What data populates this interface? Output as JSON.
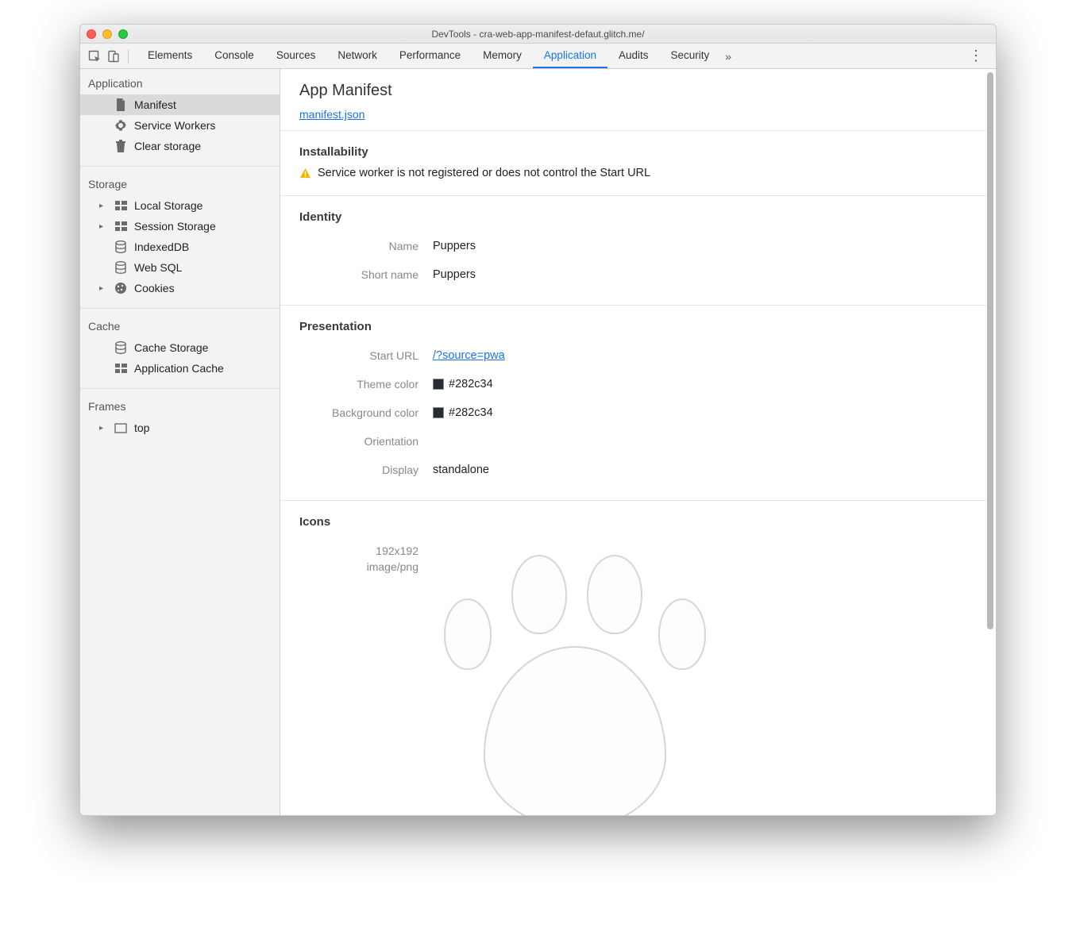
{
  "window": {
    "title": "DevTools - cra-web-app-manifest-defaut.glitch.me/"
  },
  "tabs": {
    "items": [
      "Elements",
      "Console",
      "Sources",
      "Network",
      "Performance",
      "Memory",
      "Application",
      "Audits",
      "Security"
    ],
    "active": "Application"
  },
  "sidebar": {
    "groups": [
      {
        "title": "Application",
        "items": [
          {
            "id": "manifest",
            "label": "Manifest",
            "icon": "file",
            "selected": true
          },
          {
            "id": "sw",
            "label": "Service Workers",
            "icon": "gear"
          },
          {
            "id": "clear",
            "label": "Clear storage",
            "icon": "trash"
          }
        ]
      },
      {
        "title": "Storage",
        "items": [
          {
            "id": "local",
            "label": "Local Storage",
            "icon": "grid",
            "tree": true
          },
          {
            "id": "session",
            "label": "Session Storage",
            "icon": "grid",
            "tree": true
          },
          {
            "id": "idb",
            "label": "IndexedDB",
            "icon": "db"
          },
          {
            "id": "websql",
            "label": "Web SQL",
            "icon": "db"
          },
          {
            "id": "cookies",
            "label": "Cookies",
            "icon": "cookie",
            "tree": true
          }
        ]
      },
      {
        "title": "Cache",
        "items": [
          {
            "id": "cachestore",
            "label": "Cache Storage",
            "icon": "db"
          },
          {
            "id": "appcache",
            "label": "Application Cache",
            "icon": "grid"
          }
        ]
      },
      {
        "title": "Frames",
        "items": [
          {
            "id": "top",
            "label": "top",
            "icon": "frame",
            "tree": true
          }
        ]
      }
    ]
  },
  "manifest": {
    "title": "App Manifest",
    "link": "manifest.json",
    "installability": {
      "heading": "Installability",
      "warning": "Service worker is not registered or does not control the Start URL"
    },
    "identity": {
      "heading": "Identity",
      "name_label": "Name",
      "name": "Puppers",
      "shortname_label": "Short name",
      "shortname": "Puppers"
    },
    "presentation": {
      "heading": "Presentation",
      "starturl_label": "Start URL",
      "starturl": "/?source=pwa",
      "theme_label": "Theme color",
      "theme": "#282c34",
      "bg_label": "Background color",
      "bg": "#282c34",
      "orientation_label": "Orientation",
      "orientation": "",
      "display_label": "Display",
      "display": "standalone"
    },
    "icons": {
      "heading": "Icons",
      "size": "192x192",
      "mime": "image/png"
    }
  }
}
